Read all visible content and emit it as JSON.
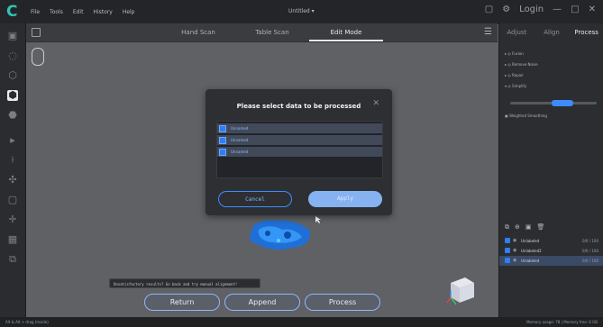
{
  "titlebar": {
    "menu": [
      "File",
      "Tools",
      "Edit",
      "History",
      "Help"
    ],
    "window_title": "Untitled ▾",
    "login": "Login",
    "icons": [
      "unknown-icon",
      "settings-icon",
      "minimize-icon",
      "maximize-icon",
      "close-icon"
    ]
  },
  "modes": {
    "tabs": [
      "Hand Scan",
      "Table Scan",
      "Edit Mode"
    ],
    "active": "Edit Mode"
  },
  "right_panel": {
    "tabs": [
      "Adjust",
      "Align",
      "Process"
    ],
    "active_tab": "Process",
    "options": [
      "Fusion",
      "Remove Noise",
      "Repair",
      "Simplify"
    ],
    "option_sub": "Weighted Smoothing",
    "data_rows": [
      {
        "name": "Unlabeled",
        "points": "0/0 / 100"
      },
      {
        "name": "Unlabeled2",
        "points": "0/0 / 100"
      },
      {
        "name": "Unlabeled",
        "points": "0/0 / 100"
      }
    ]
  },
  "dialog": {
    "title": "Please select data to be processed",
    "items": [
      "Unnamed",
      "Unnamed",
      "Unnamed"
    ],
    "cancel": "Cancel",
    "apply": "Apply"
  },
  "bottom": {
    "tooltip": "Unsatisfactory results? Go back and try manual alignment!",
    "buttons": [
      "Return",
      "Append",
      "Process"
    ]
  },
  "statusbar": {
    "left": "Alt & Alt + drag (Inside)",
    "right": "Memory usage: 78 | Memory free: 6 GB"
  }
}
